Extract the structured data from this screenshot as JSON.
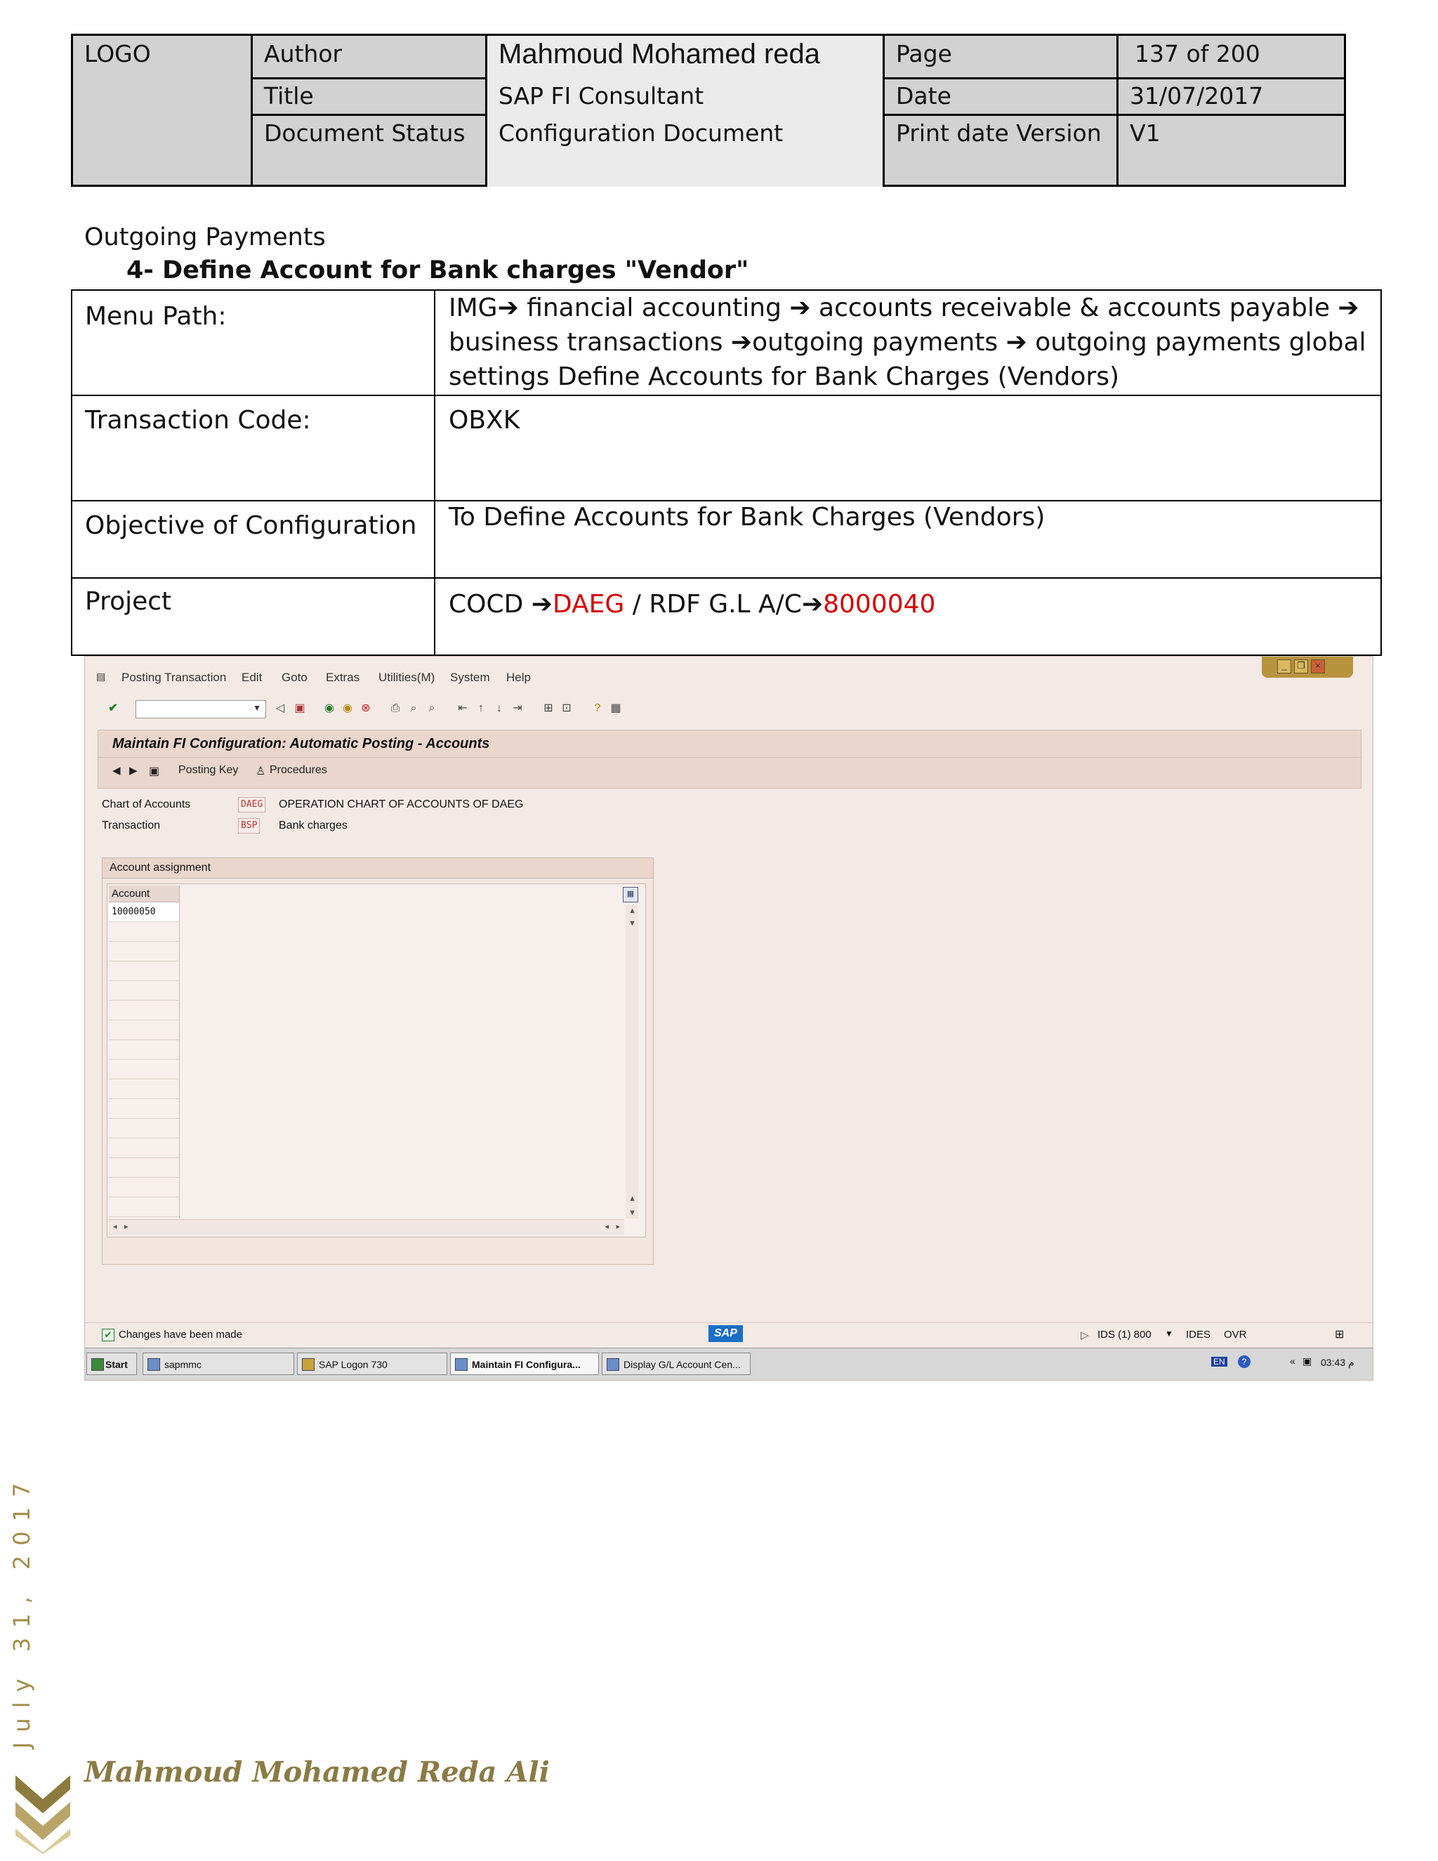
{
  "header": {
    "logo": "LOGO",
    "author_label": "Author",
    "author_value": "Mahmoud Mohamed reda",
    "page_label": "Page",
    "page_value": "137 of 200",
    "title_label": "Title",
    "title_value": "SAP FI Consultant",
    "date_label": "Date",
    "date_value": "31/07/2017",
    "status_label": "Document Status",
    "status_value": "Configuration Document",
    "print_label": "Print date Version",
    "print_value": "V1"
  },
  "section": {
    "title": "Outgoing Payments",
    "subtitle": "4-   Define Account for Bank charges \"Vendor\""
  },
  "config_table": {
    "menu_path_label": "Menu Path:",
    "menu_path_line1_a": "IMG",
    "menu_path_line1_b": " financial accounting ",
    "menu_path_line1_c": " accounts receivable & accounts payable ",
    "menu_path_line2_a": "business transactions ",
    "menu_path_line2_b": "outgoing payments ",
    "menu_path_line2_c": " outgoing payments global",
    "menu_path_line3": "settings  Define Accounts for Bank Charges (Vendors)",
    "arrow": "➔",
    "tcode_label": "Transaction Code:",
    "tcode_value": "OBXK",
    "objective_label": "Objective of Configuration",
    "objective_value": "To Define Accounts for Bank Charges (Vendors)",
    "project_label": "Project",
    "project_cocd": "COCD ",
    "project_cocd_value": "DAEG",
    "project_mid": " / RDF  G.L A/C",
    "project_gl_value": "8000040"
  },
  "sap": {
    "menu": [
      "Posting Transaction",
      "Edit",
      "Goto",
      "Extras",
      "Utilities(M)",
      "System",
      "Help"
    ],
    "screen_title": "Maintain FI Configuration: Automatic Posting - Accounts",
    "posting_key": "Posting Key",
    "procedures": "Procedures",
    "chart_label": "Chart of Accounts",
    "chart_value": "DAEG",
    "chart_desc": "OPERATION CHART OF ACCOUNTS OF DAEG",
    "trans_label": "Transaction",
    "trans_value": "BSP",
    "trans_desc": "Bank charges",
    "assign_group": "Account assignment",
    "account_col": "Account",
    "account_value": "10000050",
    "status_msg": "Changes have been made",
    "sap_logo": "SAP",
    "system_info": "IDS (1) 800",
    "client": "IDES",
    "mode": "OVR",
    "tasks": [
      "Start",
      "sapmmc",
      "SAP Logon 730",
      "Maintain FI Configura...",
      "Display G/L Account Cen..."
    ],
    "lang": "EN",
    "clock": "03:43 م"
  },
  "footer": {
    "date": "July 31, 2017",
    "name": "Mahmoud Mohamed Reda Ali"
  }
}
